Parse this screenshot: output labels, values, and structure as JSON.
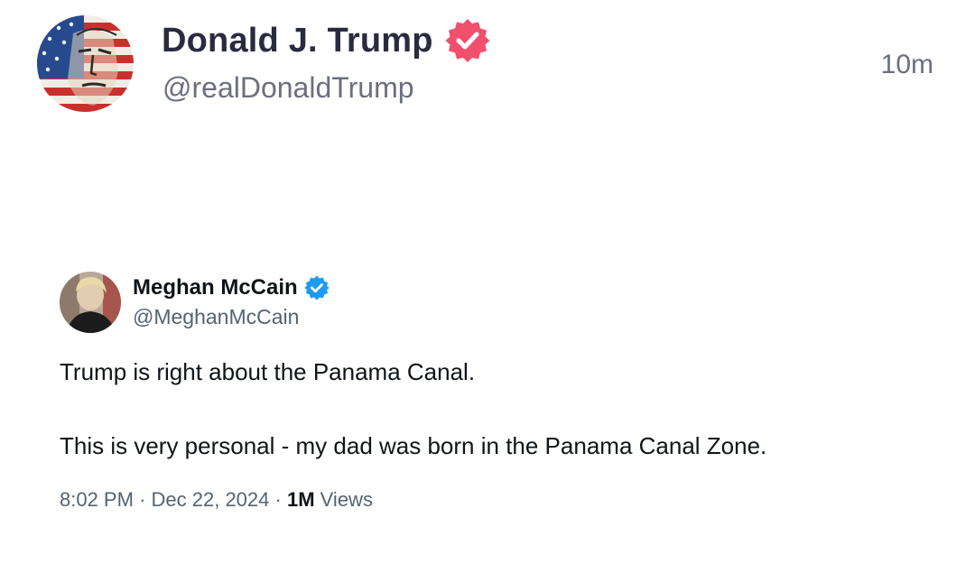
{
  "post": {
    "author_name": "Donald J. Trump",
    "author_handle": "@realDonaldTrump",
    "time_ago": "10m",
    "verified_icon": "verified-badge-icon",
    "verified_color": "#f0506e"
  },
  "quoted_tweet": {
    "author_name": "Meghan McCain",
    "author_handle": "@MeghanMcCain",
    "verified_icon": "verified-badge-icon",
    "verified_color": "#1d9bf0",
    "text_lines": [
      "Trump is right about the Panama Canal.",
      "This is very personal - my dad was born in the Panama Canal Zone."
    ],
    "time": "8:02 PM",
    "separator": "·",
    "date": "Dec 22, 2024",
    "views_count": "1M",
    "views_label": "Views"
  }
}
